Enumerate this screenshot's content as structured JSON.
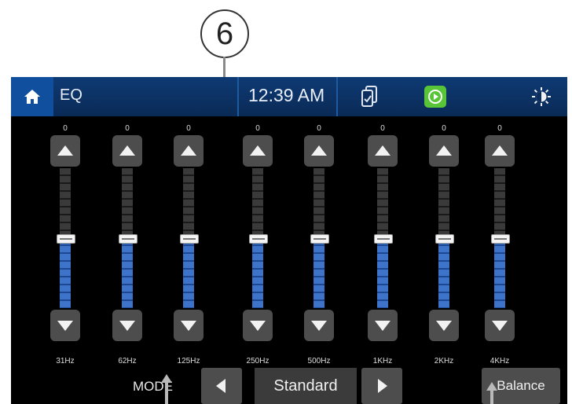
{
  "callout": {
    "number": "6"
  },
  "topbar": {
    "title": "EQ",
    "clock": "12:39 AM",
    "icons": [
      "home-icon",
      "phone-mirror-icon",
      "carplay-icon",
      "brightness-icon"
    ],
    "colors": {
      "bar": "#0b2e5e",
      "home": "#0f4f9e",
      "carplay": "#58c437"
    }
  },
  "eq": {
    "bands": [
      {
        "freq": "31Hz",
        "value": "0",
        "level": 0.5
      },
      {
        "freq": "62Hz",
        "value": "0",
        "level": 0.5
      },
      {
        "freq": "125Hz",
        "value": "0",
        "level": 0.5
      },
      {
        "freq": "250Hz",
        "value": "0",
        "level": 0.5
      },
      {
        "freq": "500Hz",
        "value": "0",
        "level": 0.5
      },
      {
        "freq": "1KHz",
        "value": "0",
        "level": 0.5
      },
      {
        "freq": "2KHz",
        "value": "0",
        "level": 0.5
      },
      {
        "freq": "4KHz",
        "value": "0",
        "level": 0.5
      }
    ],
    "fill_color": "#3d74c9"
  },
  "bottom": {
    "mode_label": "MODE",
    "mode_value": "Standard",
    "balance_label": "Balance"
  }
}
